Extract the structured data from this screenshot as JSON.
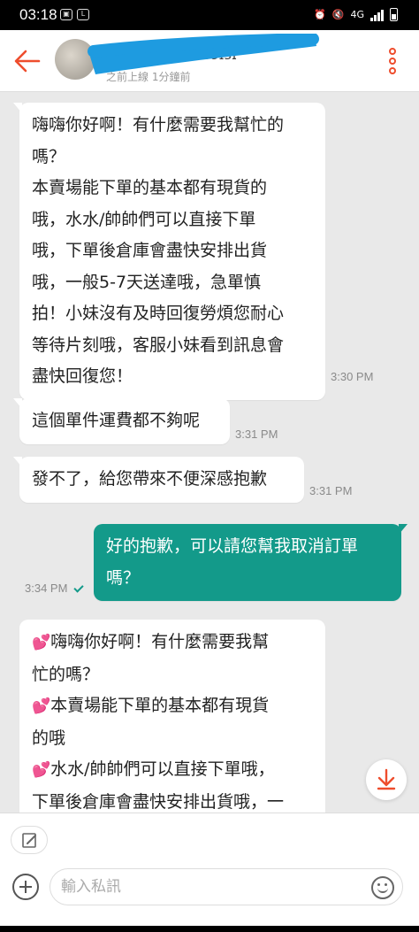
{
  "status_bar": {
    "time": "03:18",
    "network": "4G",
    "left_icons": [
      "image-icon",
      "line-app-icon"
    ],
    "right_icons": [
      "alarm-icon",
      "mute-icon",
      "network-icon",
      "signal-icon",
      "battery-icon"
    ]
  },
  "header": {
    "contact_name_fragment": "ɔɔɪɜɪ",
    "online_status": "之前上線 1分鐘前",
    "back_icon": "arrow-left-icon",
    "more_icon": "more-vertical-icon",
    "accent_color": "#ee4d2d"
  },
  "messages": [
    {
      "direction": "in",
      "text": "嗨嗨你好啊！有什麼需要我幫忙的\n嗎？\n本賣場能下單的基本都有現貨的\n哦，水水/帥帥們可以直接下單\n哦，下單後倉庫會盡快安排出貨\n哦，一般5-7天送達哦，急單慎\n拍！小妹沒有及時回復勞煩您耐心\n等待片刻哦，客服小妹看到訊息會\n盡快回復您！",
      "time": "3:30 PM"
    },
    {
      "direction": "in",
      "text": "這個單件運費都不夠呢",
      "time": "3:31 PM"
    },
    {
      "direction": "in",
      "text": "發不了，給您帶來不便深感抱歉",
      "time": "3:31 PM"
    },
    {
      "direction": "out",
      "text": "好的抱歉，可以請您幫我取消訂單\n嗎？",
      "time": "3:34 PM",
      "read_icon": "check-icon"
    },
    {
      "direction": "in",
      "lines": [
        {
          "heart": "💕",
          "text": "嗨嗨你好啊！有什麼需要我幫"
        },
        {
          "heart": "",
          "text": "忙的嗎？"
        },
        {
          "heart": "💕",
          "text": "本賣場能下單的基本都有現貨"
        },
        {
          "heart": "",
          "text": "的哦"
        },
        {
          "heart": "💕",
          "text": "水水/帥帥們可以直接下單哦，"
        },
        {
          "heart": "",
          "text": "下單後倉庫會盡快安排出貨哦，一"
        }
      ]
    }
  ],
  "colors": {
    "outgoing_bubble": "#139a8a",
    "chat_background": "#e9e9e9"
  },
  "scroll_button_icon": "arrow-down-icon",
  "composer": {
    "edit_icon": "edit-icon",
    "add_icon": "plus-icon",
    "placeholder": "輸入私訊",
    "value": "",
    "emoji_icon": "emoji-icon"
  }
}
